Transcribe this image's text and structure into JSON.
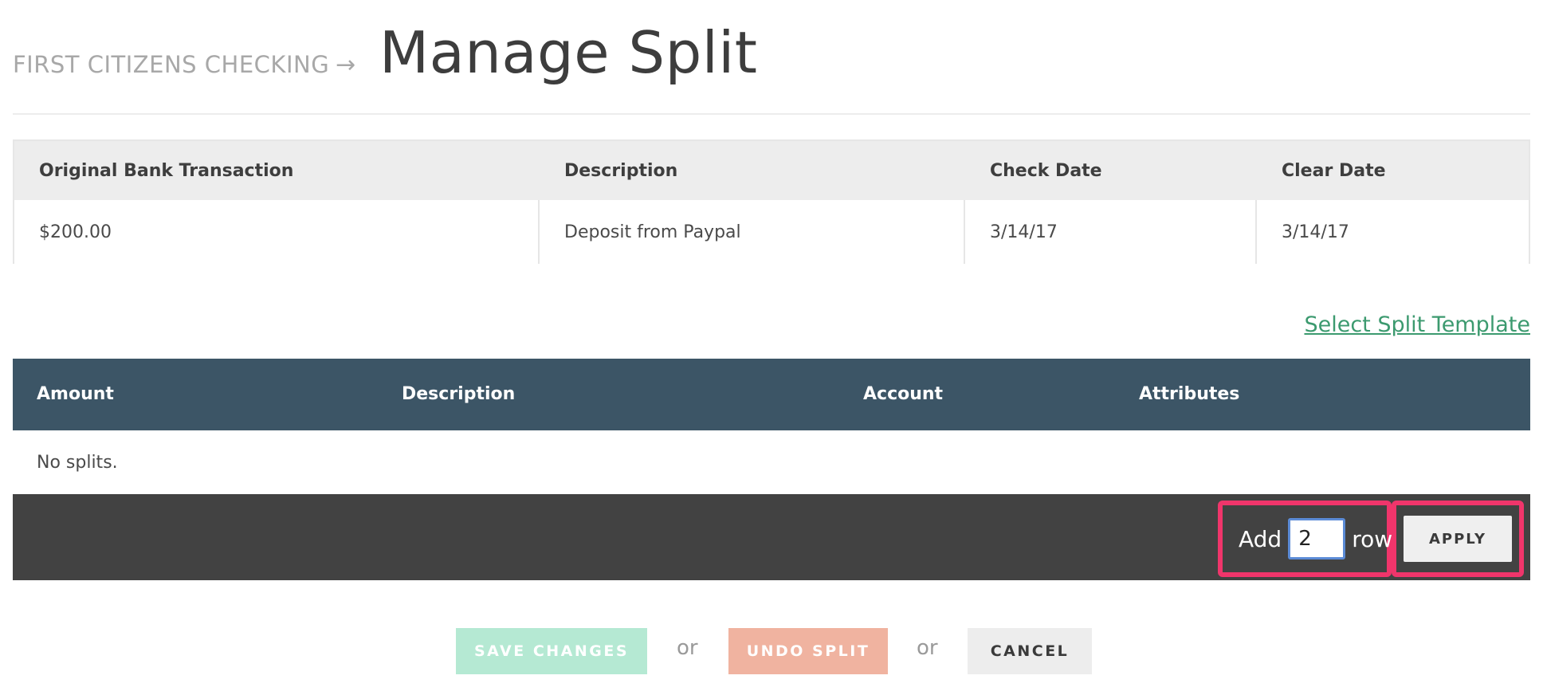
{
  "header": {
    "breadcrumb": "FIRST CITIZENS CHECKING",
    "arrow": "→",
    "title": "Manage Split"
  },
  "original_transaction": {
    "columns": [
      "Original Bank Transaction",
      "Description",
      "Check Date",
      "Clear Date"
    ],
    "row": [
      "$200.00",
      "Deposit from Paypal",
      "3/14/17",
      "3/14/17"
    ]
  },
  "template_link": "Select Split Template",
  "splits": {
    "columns": [
      "Amount",
      "Description",
      "Account",
      "Attributes"
    ],
    "empty_text": "No splits.",
    "add_rows": {
      "prefix": "Add",
      "value": "2",
      "suffix": "row",
      "apply_label": "APPLY"
    }
  },
  "actions": {
    "save_label": "SAVE CHANGES",
    "or_1": "or",
    "undo_label": "UNDO SPLIT",
    "or_2": "or",
    "cancel_label": "CANCEL"
  },
  "colors": {
    "table_header_bg": "#3c5566",
    "footer_bg": "#424242",
    "highlight_border": "#f0356b",
    "link": "#3c9a6f",
    "save_disabled": "#b5e9d3",
    "undo_disabled": "#f0b3a0"
  }
}
